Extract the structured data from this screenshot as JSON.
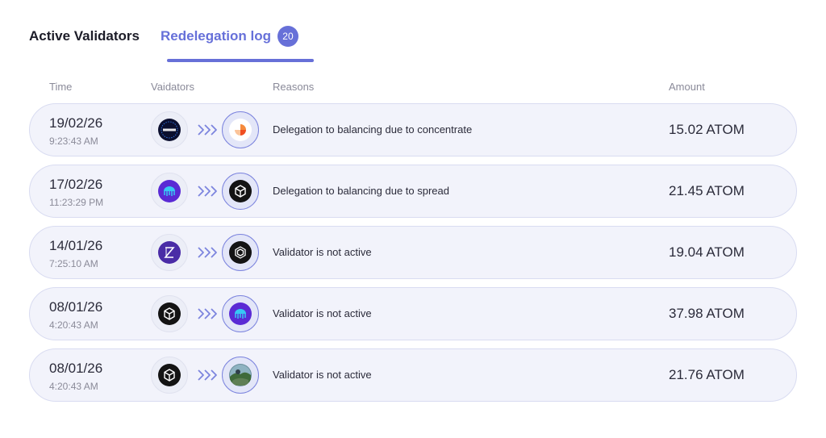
{
  "tabs": {
    "active_validators": "Active Validators",
    "redelegation_log": "Redelegation log",
    "redelegation_count": "20"
  },
  "columns": {
    "time": "Time",
    "validators": "Vaidators",
    "reasons": "Reasons",
    "amount": "Amount"
  },
  "accent_color": "#6770d8",
  "rows": [
    {
      "date": "19/02/26",
      "time": "9:23:43 AM",
      "from_icon": "chaintools-logo-icon",
      "to_icon": "orange-segment-logo-icon",
      "reason": "Delegation to balancing due to concentrate",
      "amount": "15.02 ATOM"
    },
    {
      "date": "17/02/26",
      "time": "11:23:29 PM",
      "from_icon": "purple-jellyfish-logo-icon",
      "to_icon": "cube-logo-icon",
      "reason": "Delegation to balancing due to spread",
      "amount": "21.45 ATOM"
    },
    {
      "date": "14/01/26",
      "time": "7:25:10 AM",
      "from_icon": "purple-z-logo-icon",
      "to_icon": "hexagon-logo-icon",
      "reason": "Validator is not active",
      "amount": "19.04 ATOM"
    },
    {
      "date": "08/01/26",
      "time": "4:20:43 AM",
      "from_icon": "cube-logo-icon",
      "to_icon": "purple-jellyfish-logo-icon",
      "reason": "Validator is not active",
      "amount": "37.98 ATOM"
    },
    {
      "date": "08/01/26",
      "time": "4:20:43 AM",
      "from_icon": "cube-logo-icon",
      "to_icon": "landscape-photo-logo-icon",
      "reason": "Validator is not active",
      "amount": "21.76 ATOM"
    }
  ]
}
